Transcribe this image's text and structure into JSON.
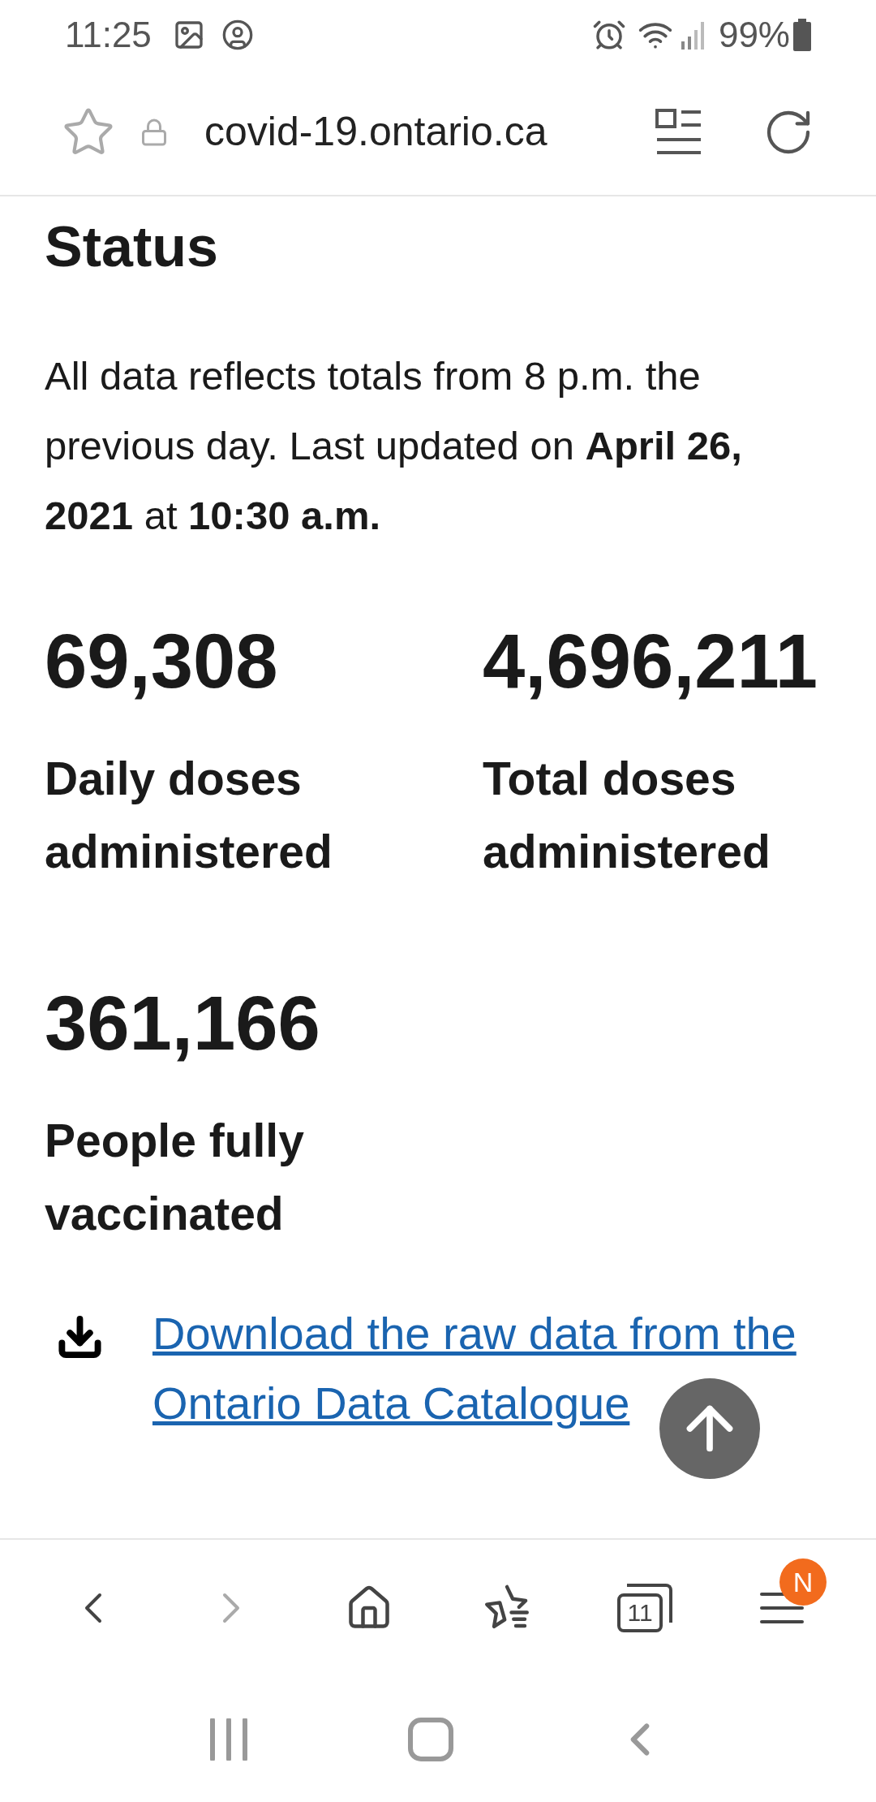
{
  "status_bar": {
    "time": "11:25",
    "battery": "99%"
  },
  "address_bar": {
    "url": "covid-19.ontario.ca"
  },
  "page": {
    "heading": "Status",
    "intro": "All data reflects totals from 8 p.m. the previous day. Last updated on **April 26, 2021** at **10:30 a.m.**",
    "stats": [
      {
        "value": "69,308",
        "label": "Daily doses administered"
      },
      {
        "value": "4,696,211",
        "label": "Total doses administered"
      },
      {
        "value": "361,166",
        "label": "People fully vaccinated"
      }
    ],
    "download_link": "Download the raw data from the Ontario Data Catalogue"
  },
  "browser_toolbar": [
    {
      "kind": "back",
      "disabled": false
    },
    {
      "kind": "forward",
      "disabled": true
    },
    {
      "kind": "home",
      "disabled": false
    },
    {
      "kind": "bookmarks",
      "disabled": false
    },
    {
      "kind": "tabs",
      "count": "11",
      "disabled": false
    },
    {
      "kind": "menu",
      "badge": "N",
      "disabled": false
    }
  ]
}
